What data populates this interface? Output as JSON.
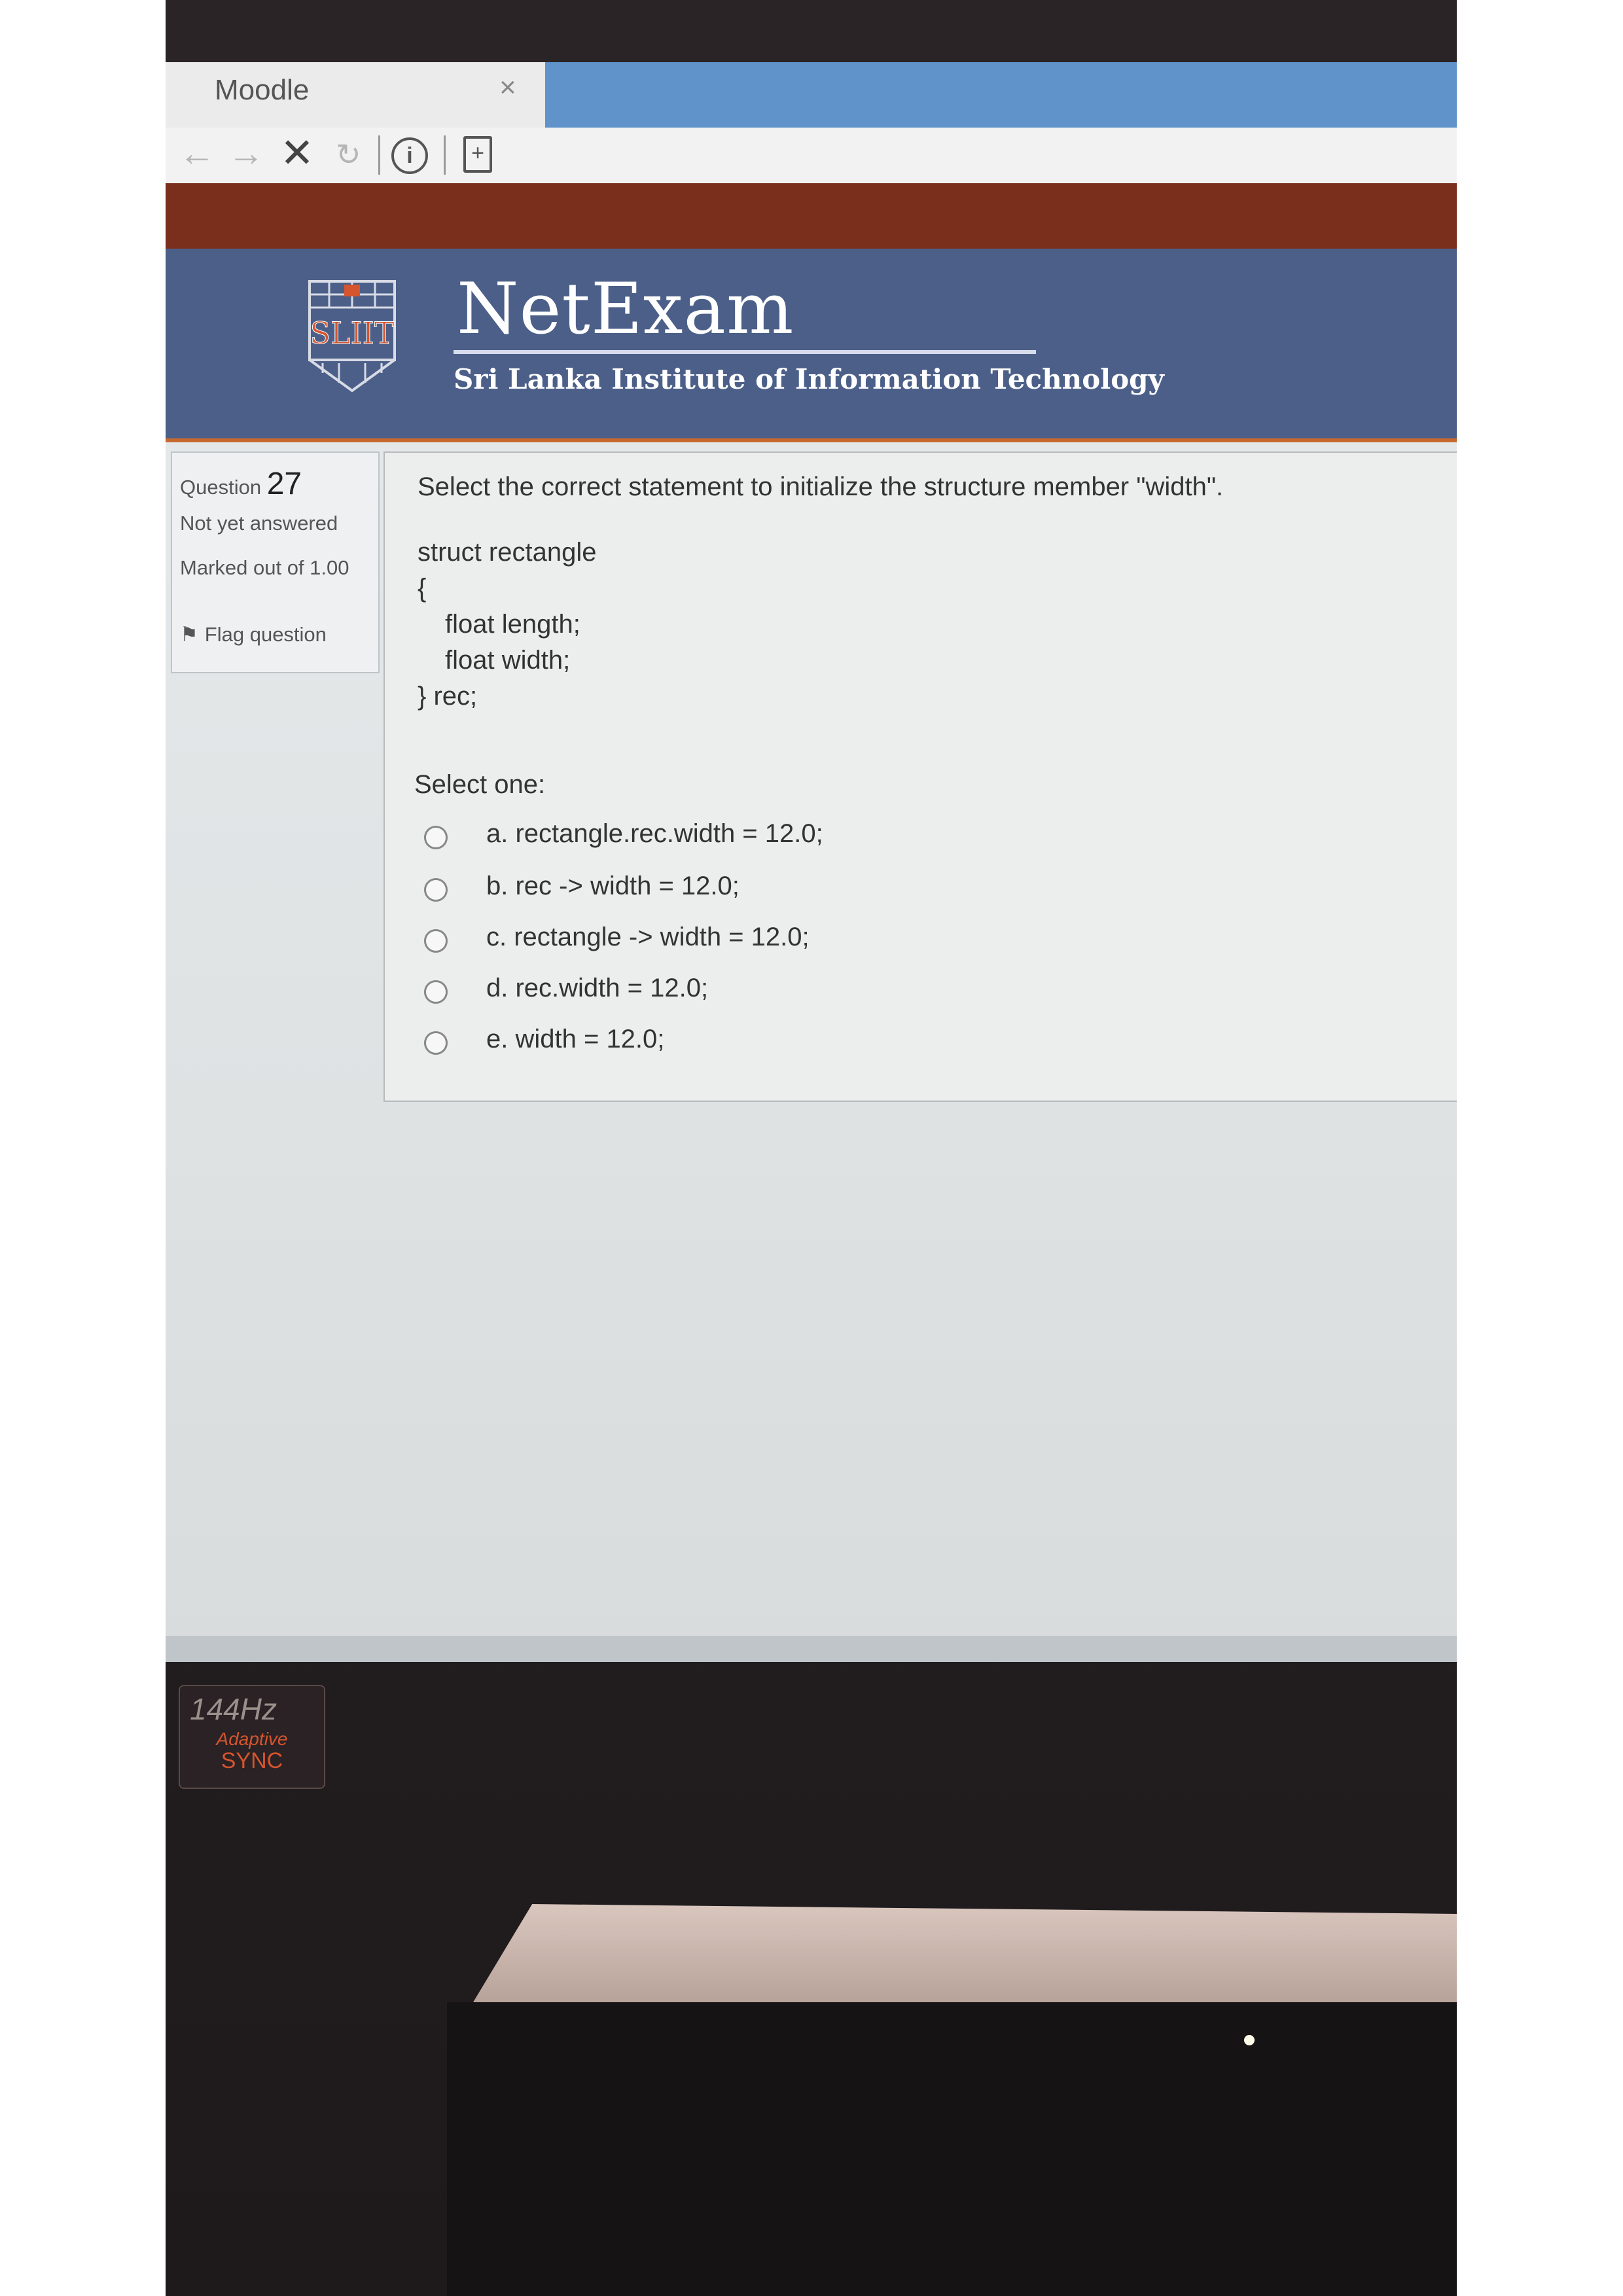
{
  "browser": {
    "tab_title": "Moodle",
    "tab_close": "×"
  },
  "toolbar": {
    "back_icon": "arrow-left-icon",
    "forward_icon": "arrow-right-icon",
    "stop_icon": "close-icon",
    "reload_icon": "reload-icon",
    "info_icon": "info-icon",
    "page_icon": "page-icon"
  },
  "site": {
    "logo_text": "SLIIT",
    "brand": "NetExam",
    "subtitle": "Sri Lanka Institute of Information Technology"
  },
  "question_info": {
    "question_prefix": "Question",
    "question_number": "27",
    "state": "Not yet answered",
    "marks": "Marked out of 1.00",
    "flag": "Flag question"
  },
  "question": {
    "text": "Select the correct statement to initialize the structure member \"width\".",
    "code": [
      "struct rectangle",
      "{",
      "float length;",
      "float width;",
      "} rec;"
    ],
    "select_one": "Select one:",
    "options": [
      "a. rectangle.rec.width = 12.0;",
      "b. rec -> width = 12.0;",
      "c. rectangle -> width = 12.0;",
      "d. rec.width = 12.0;",
      "e. width = 12.0;"
    ]
  },
  "monitor_badge": {
    "hz": "144Hz",
    "adaptive": "Adaptive",
    "sync": "SYNC"
  },
  "colors": {
    "header_bg": "#4b5f88",
    "header_border": "#c7692e",
    "tab_accent": "#5f93c9"
  }
}
